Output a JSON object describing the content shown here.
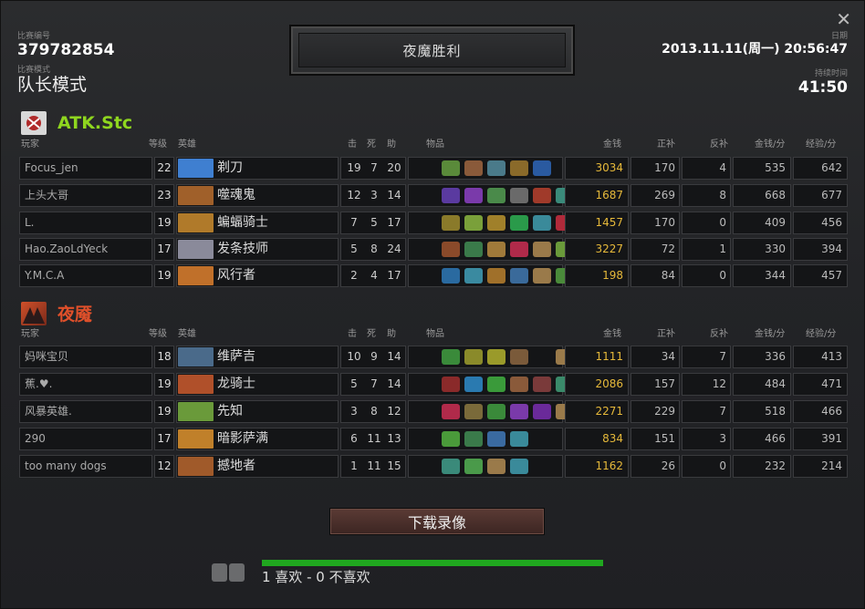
{
  "match": {
    "id_label": "比赛编号",
    "id": "379782854",
    "mode_label": "比赛模式",
    "mode": "队长模式",
    "date_label": "日期",
    "date": "2013.11.11(周一) 20:56:47",
    "duration_label": "持续时间",
    "duration": "41:50",
    "winner": "夜魔胜利"
  },
  "headers": {
    "player": "玩家",
    "level": "等级",
    "hero": "英雄",
    "kills": "击",
    "deaths": "死",
    "assists": "助",
    "items": "物品",
    "gold": "金钱",
    "last_hits": "正补",
    "denies": "反补",
    "gpm": "金钱/分",
    "xpm": "经验/分"
  },
  "teams": [
    {
      "name": "ATK.Stc",
      "color": "#8fd61f",
      "players": [
        {
          "name": "Focus_jen",
          "level": "22",
          "hero": "剃刀",
          "k": "19",
          "d": "7",
          "a": "20",
          "gold": "3034",
          "lh": "170",
          "dn": "4",
          "gpm": "535",
          "xpm": "642",
          "hero_color": "#3f7fd0",
          "items": [
            "#5a8a3a",
            "#8a5a3a",
            "#4a7a8a",
            "#8a6a2a",
            "#2a5aa0"
          ]
        },
        {
          "name": "上头大哥",
          "level": "23",
          "hero": "噬魂鬼",
          "k": "12",
          "d": "3",
          "a": "14",
          "gold": "1687",
          "lh": "269",
          "dn": "8",
          "gpm": "668",
          "xpm": "677",
          "hero_color": "#a0602a",
          "items": [
            "#5a3aa0",
            "#7a3aaa",
            "#4a8a4a",
            "#6a6a6a",
            "#a03a2a",
            "#3a8a7a"
          ]
        },
        {
          "name": "L.",
          "level": "19",
          "hero": "蝙蝠骑士",
          "k": "7",
          "d": "5",
          "a": "17",
          "gold": "1457",
          "lh": "170",
          "dn": "0",
          "gpm": "409",
          "xpm": "456",
          "hero_color": "#b07a2a",
          "items": [
            "#8a7a2a",
            "#7aa03a",
            "#a0802a",
            "#2a9a4a",
            "#3a8a9a",
            "#b02a3a"
          ]
        },
        {
          "name": "Hao.ZaoLdYeck",
          "level": "17",
          "hero": "发条技师",
          "k": "5",
          "d": "8",
          "a": "24",
          "gold": "3227",
          "lh": "72",
          "dn": "1",
          "gpm": "330",
          "xpm": "394",
          "hero_color": "#8a8a9a",
          "items": [
            "#8a4a2a",
            "#3a7a4a",
            "#a07a3a",
            "#b02a4a",
            "#9a7a4a",
            "#6a9a3a"
          ]
        },
        {
          "name": "Y.M.C.A",
          "level": "19",
          "hero": "风行者",
          "k": "2",
          "d": "4",
          "a": "17",
          "gold": "198",
          "lh": "84",
          "dn": "0",
          "gpm": "344",
          "xpm": "457",
          "hero_color": "#c0702a",
          "items": [
            "#2a6aa0",
            "#3a8aa0",
            "#a0702a",
            "#3a6a9a",
            "#9a7a4a",
            "#4a8a3a"
          ]
        }
      ]
    },
    {
      "name": "夜魇",
      "color": "#e0502a",
      "players": [
        {
          "name": "妈咪宝贝",
          "level": "18",
          "hero": "维萨吉",
          "k": "10",
          "d": "9",
          "a": "14",
          "gold": "1111",
          "lh": "34",
          "dn": "7",
          "gpm": "336",
          "xpm": "413",
          "hero_color": "#4a6a8a",
          "items": [
            "#3a8a3a",
            "#8a8a2a",
            "#9a9a2a",
            "#7a5a3a",
            "",
            "#9a7a4a"
          ]
        },
        {
          "name": "蕉.♥.",
          "level": "19",
          "hero": "龙骑士",
          "k": "5",
          "d": "7",
          "a": "14",
          "gold": "2086",
          "lh": "157",
          "dn": "12",
          "gpm": "484",
          "xpm": "471",
          "hero_color": "#b0502a",
          "items": [
            "#8a2a2a",
            "#2a7ab0",
            "#3a9a3a",
            "#8a5a3a",
            "#7a3a3a",
            "#3a8a6a"
          ]
        },
        {
          "name": "风暴英雄.",
          "level": "19",
          "hero": "先知",
          "k": "3",
          "d": "8",
          "a": "12",
          "gold": "2271",
          "lh": "229",
          "dn": "7",
          "gpm": "518",
          "xpm": "466",
          "hero_color": "#6a9a3a",
          "items": [
            "#b02a4a",
            "#7a6a3a",
            "#3a8a3a",
            "#7a3aaa",
            "#6a2a9a",
            "#9a7a4a"
          ]
        },
        {
          "name": "290",
          "level": "17",
          "hero": "暗影萨满",
          "k": "6",
          "d": "11",
          "a": "13",
          "gold": "834",
          "lh": "151",
          "dn": "3",
          "gpm": "466",
          "xpm": "391",
          "hero_color": "#c0802a",
          "items": [
            "#4a9a3a",
            "#3a7a4a",
            "#3a6aa0",
            "#3a8a9a"
          ]
        },
        {
          "name": "too many dogs",
          "level": "12",
          "hero": "撼地者",
          "k": "1",
          "d": "11",
          "a": "15",
          "gold": "1162",
          "lh": "26",
          "dn": "0",
          "gpm": "232",
          "xpm": "214",
          "hero_color": "#a05a2a",
          "items": [
            "#3a8a7a",
            "#4a9a4a",
            "#9a7a4a",
            "#3a8a9a"
          ]
        }
      ]
    }
  ],
  "download_label": "下载录像",
  "rating": {
    "text": "1 喜欢 - 0 不喜欢",
    "like_fraction": 1.0
  },
  "colors": {
    "gold": "#e6b93a",
    "radiant": "#8fd61f",
    "dire": "#e0502a",
    "like_bar": "#20a71f"
  }
}
